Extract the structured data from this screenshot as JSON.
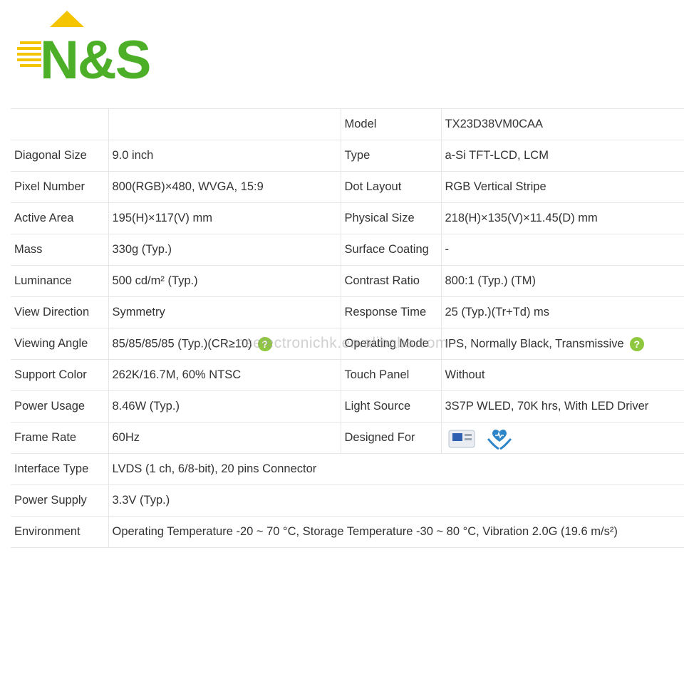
{
  "brand": {
    "name": "N&S",
    "colors": {
      "green": "#4caf27",
      "yellow": "#f5c400"
    }
  },
  "watermark": "nselectronichk.en.alibaba.com",
  "rows": [
    {
      "l1": "",
      "v1": "",
      "l2": "Model",
      "v2": "TX23D38VM0CAA"
    },
    {
      "l1": "Diagonal Size",
      "v1": "9.0 inch",
      "l2": "Type",
      "v2": "a-Si TFT-LCD, LCM"
    },
    {
      "l1": "Pixel Number",
      "v1": "800(RGB)×480, WVGA, 15:9",
      "l2": "Dot Layout",
      "v2": "RGB Vertical Stripe"
    },
    {
      "l1": "Active Area",
      "v1": "195(H)×117(V) mm",
      "l2": "Physical Size",
      "v2": "218(H)×135(V)×11.45(D) mm"
    },
    {
      "l1": "Mass",
      "v1": "330g (Typ.)",
      "l2": "Surface Coating",
      "v2": "-"
    },
    {
      "l1": "Luminance",
      "v1": "500 cd/m² (Typ.)",
      "l2": "Contrast Ratio",
      "v2": "800:1 (Typ.) (TM)"
    },
    {
      "l1": "View Direction",
      "v1": "Symmetry",
      "l2": "Response Time",
      "v2": "25 (Typ.)(Tr+Td) ms"
    },
    {
      "l1": "Viewing Angle",
      "v1": "85/85/85/85 (Typ.)(CR≥10)",
      "l2": "Operating Mode",
      "v2": "IPS, Normally Black, Transmissive"
    },
    {
      "l1": "Support Color",
      "v1": "262K/16.7M, 60% NTSC",
      "l2": "Touch Panel",
      "v2": "Without"
    },
    {
      "l1": "Power Usage",
      "v1": "8.46W (Typ.)",
      "l2": "Light Source",
      "v2": "3S7P WLED, 70K hrs, With LED Driver"
    },
    {
      "l1": "Frame Rate",
      "v1": "60Hz",
      "l2": "Designed For",
      "v2": ""
    },
    {
      "l1": "Interface Type",
      "v1": "LVDS (1 ch, 6/8-bit), 20 pins Connector"
    },
    {
      "l1": "Power Supply",
      "v1": "3.3V (Typ.)"
    },
    {
      "l1": "Environment",
      "v1": "Operating Temperature -20 ~ 70 °C, Storage Temperature -30 ~ 80 °C, Vibration 2.0G (19.6 m/s²)"
    }
  ],
  "icons": {
    "help": "question-mark",
    "designed_for": [
      "medical-device-icon",
      "healthcare-hands-icon"
    ]
  },
  "help_glyph": "?"
}
